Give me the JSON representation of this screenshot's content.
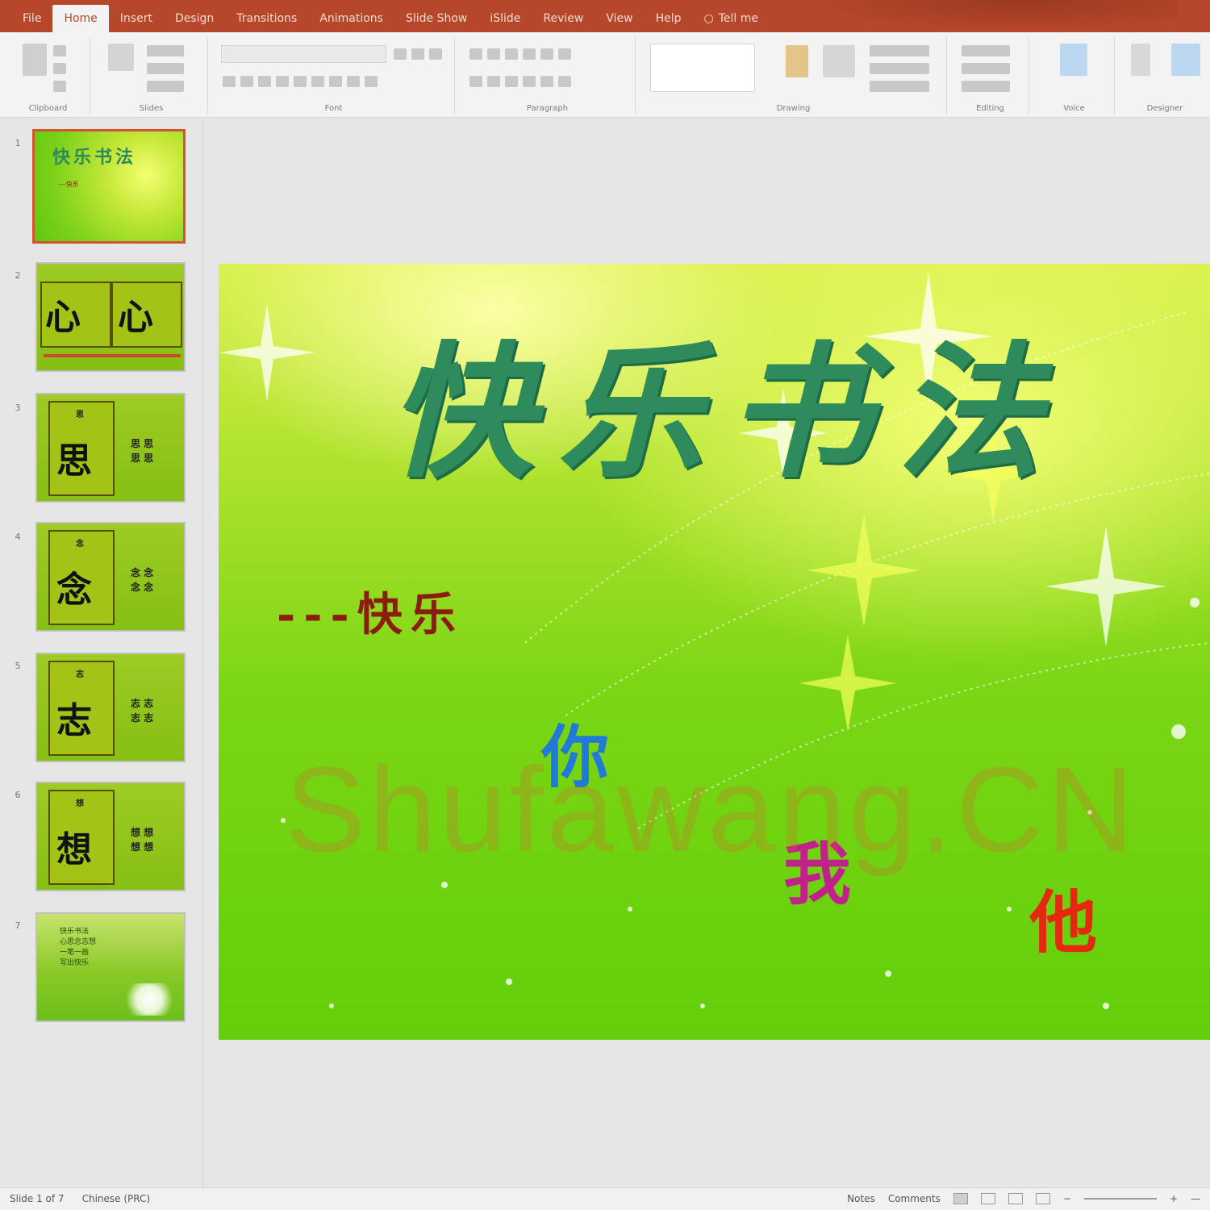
{
  "app": {
    "accent": "#b7472a"
  },
  "tabs": [
    {
      "label": "File"
    },
    {
      "label": "Home",
      "active": true
    },
    {
      "label": "Insert"
    },
    {
      "label": "Design"
    },
    {
      "label": "Transitions"
    },
    {
      "label": "Animations"
    },
    {
      "label": "Slide Show"
    },
    {
      "label": "iSlide"
    },
    {
      "label": "Review"
    },
    {
      "label": "View"
    },
    {
      "label": "Help"
    },
    {
      "label": "Tell me"
    }
  ],
  "ribbon": {
    "groups": [
      {
        "label": "Clipboard"
      },
      {
        "label": "Slides"
      },
      {
        "label": "Font"
      },
      {
        "label": "Paragraph"
      },
      {
        "label": "Drawing"
      },
      {
        "label": "Editing"
      },
      {
        "label": "Voice"
      },
      {
        "label": "Designer"
      }
    ]
  },
  "thumbnails": [
    {
      "number": "1",
      "title": "快乐书法",
      "subtitle": "---快乐"
    },
    {
      "number": "2",
      "chars": [
        "心",
        "心"
      ]
    },
    {
      "number": "3",
      "char": "思",
      "tag": "思",
      "side": "思 思\n思 思"
    },
    {
      "number": "4",
      "char": "念",
      "tag": "念",
      "side": "念 念\n念 念"
    },
    {
      "number": "5",
      "char": "志",
      "tag": "志",
      "side": "志 志\n志 志"
    },
    {
      "number": "6",
      "char": "想",
      "tag": "想",
      "side": "想 想\n想 想"
    },
    {
      "number": "7",
      "poem": [
        "快乐书法",
        "心思念志想",
        "一笔一画",
        "写出快乐"
      ]
    }
  ],
  "slide": {
    "title": "快乐书法",
    "subtitle": "---快乐",
    "word_you": "你",
    "word_me": "我",
    "word_him": "他",
    "watermark": "Shufawang.CN",
    "colors": {
      "title": "#2e8b5c",
      "subtitle": "#8a1d0d",
      "you": "#1f7ad8",
      "me": "#c2208a",
      "him": "#e32a0e"
    }
  },
  "statusbar": {
    "slide_info": "Slide 1 of 7",
    "language": "Chinese (PRC)",
    "notes": "Notes",
    "comments": "Comments",
    "zoom": "—"
  }
}
